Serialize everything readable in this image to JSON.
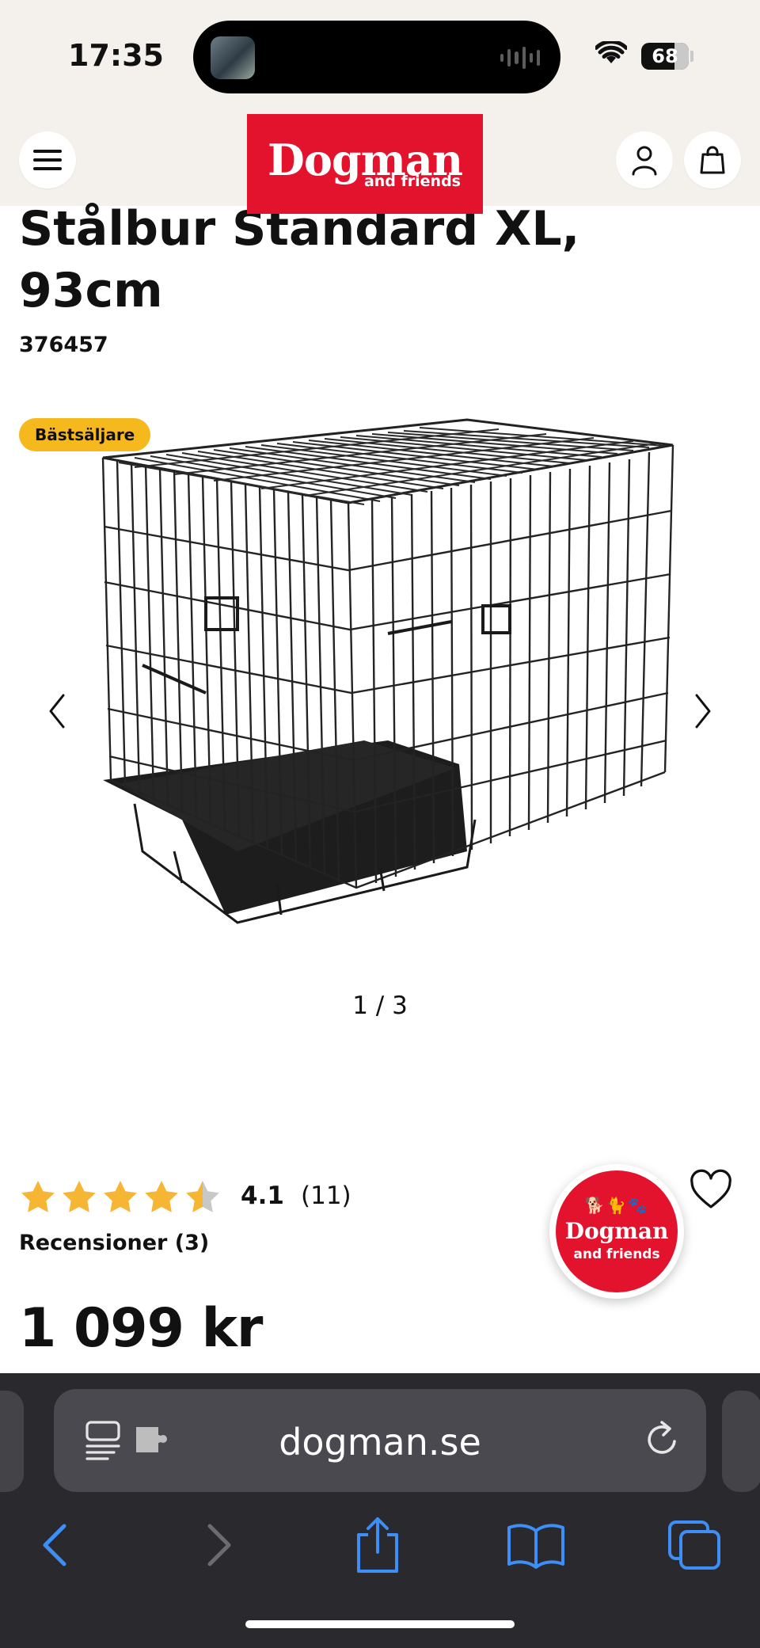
{
  "status_bar": {
    "time": "17:35",
    "battery": "68"
  },
  "header": {
    "logo_main": "Dogman",
    "logo_sub": "and friends",
    "menu_icon": "hamburger-icon",
    "account_icon": "user-icon",
    "cart_icon": "shopping-bag-icon"
  },
  "product": {
    "title": "Stålbur Standard XL, 93cm",
    "sku": "376457",
    "badge": "Bästsäljare",
    "gallery_pager": "1 / 3",
    "gallery_current": 1,
    "gallery_total": 3,
    "rating": 4.1,
    "rating_label": "4.1",
    "rating_count": "(11)",
    "reviews_link": "Recensioner (3)",
    "price": "1 099 kr"
  },
  "chat_badge": {
    "main": "Dogman",
    "sub": "and friends"
  },
  "browser": {
    "url": "dogman.se",
    "toolbar": [
      "back-icon",
      "forward-icon",
      "share-icon",
      "bookmarks-icon",
      "tabs-icon"
    ]
  },
  "colors": {
    "brand_red": "#e3122d",
    "badge_yellow": "#f6b91d",
    "star": "#f6b533",
    "safari_blue": "#3d8ef7"
  }
}
